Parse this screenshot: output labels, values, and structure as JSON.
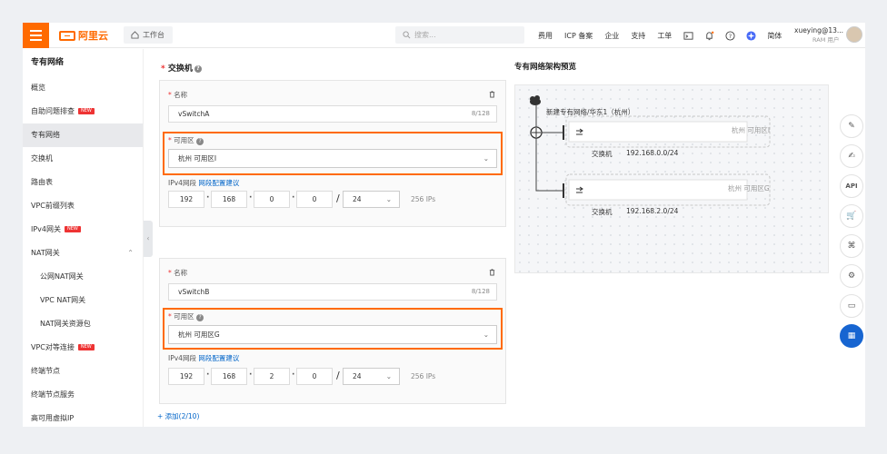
{
  "header": {
    "logo": "阿里云",
    "workbench": "工作台",
    "search_placeholder": "搜索...",
    "nav": [
      "费用",
      "ICP 备案",
      "企业",
      "支持",
      "工单"
    ],
    "lang": "简体",
    "user_name": "xueying@13...",
    "user_role": "RAM 用户"
  },
  "sidebar": {
    "title": "专有网络",
    "new_badge": "NEW",
    "items": [
      {
        "label": "概览",
        "new": false,
        "sub": false,
        "active": false
      },
      {
        "label": "自助问题排查",
        "new": true,
        "sub": false,
        "active": false
      },
      {
        "label": "专有网络",
        "new": false,
        "sub": false,
        "active": true
      },
      {
        "label": "交换机",
        "new": false,
        "sub": false,
        "active": false
      },
      {
        "label": "路由表",
        "new": false,
        "sub": false,
        "active": false
      },
      {
        "label": "VPC前缀列表",
        "new": false,
        "sub": false,
        "active": false
      },
      {
        "label": "IPv4网关",
        "new": true,
        "sub": false,
        "active": false
      },
      {
        "label": "NAT网关",
        "new": false,
        "sub": false,
        "active": false,
        "caret": "⌃"
      },
      {
        "label": "公网NAT网关",
        "new": false,
        "sub": true,
        "active": false
      },
      {
        "label": "VPC NAT网关",
        "new": false,
        "sub": true,
        "active": false
      },
      {
        "label": "NAT网关资源包",
        "new": false,
        "sub": true,
        "active": false
      },
      {
        "label": "VPC对等连接",
        "new": true,
        "sub": false,
        "active": false
      },
      {
        "label": "终端节点",
        "new": false,
        "sub": false,
        "active": false
      },
      {
        "label": "终端节点服务",
        "new": false,
        "sub": false,
        "active": false
      },
      {
        "label": "高可用虚拟IP",
        "new": false,
        "sub": false,
        "active": false
      }
    ]
  },
  "form": {
    "section_title": "交换机",
    "name_label": "名称",
    "zone_label": "可用区",
    "ipv4_label": "IPv4网段",
    "ipv4_link": "网段配置建议",
    "add_label": "添加(2/10)",
    "switches": [
      {
        "name": "vSwitchA",
        "count": "8/128",
        "zone": "杭州 可用区I",
        "octets": [
          "192",
          "168",
          "0",
          "0"
        ],
        "mask": "24",
        "ips": "256 IPs"
      },
      {
        "name": "vSwitchB",
        "count": "8/128",
        "zone": "杭州 可用区G",
        "octets": [
          "192",
          "168",
          "2",
          "0"
        ],
        "mask": "24",
        "ips": "256 IPs"
      }
    ]
  },
  "preview": {
    "title": "专有网络架构预览",
    "vpc_label": "新建专有网络/华东1（杭州）",
    "switch_word": "交换机",
    "zones": [
      {
        "zone": "杭州 可用区I",
        "cidr": "192.168.0.0/24"
      },
      {
        "zone": "杭州 可用区G",
        "cidr": "192.168.2.0/24"
      }
    ]
  },
  "rail": {
    "icons": [
      "edit-icon",
      "notes-icon",
      "api-icon",
      "cart-icon",
      "code-icon",
      "settings-icon",
      "chat-icon",
      "apps-icon"
    ],
    "api_text": "API"
  },
  "colors": {
    "brand": "#ff6a00",
    "link": "#0064c8",
    "rail_active": "#1765d1"
  }
}
